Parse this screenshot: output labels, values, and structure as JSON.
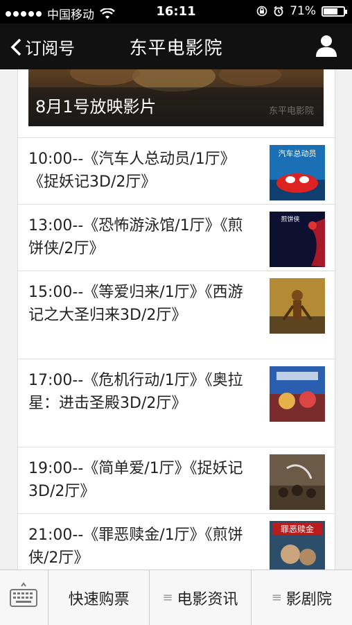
{
  "status_bar": {
    "carrier": "中国移动",
    "time": "16:11",
    "battery": "71%",
    "battery_level": 0.71
  },
  "nav": {
    "back_label": "订阅号",
    "title": "东平电影院"
  },
  "banner": {
    "caption": "8月1号放映影片",
    "watermark": "东平电影院"
  },
  "schedule": [
    {
      "text": "10:00--《汽车人总动员/1厅》《捉妖记3D/2厅》",
      "poster_title": "汽车总动员"
    },
    {
      "text": "13:00--《恐怖游泳馆/1厅》《煎饼侠/2厅》",
      "poster_title": "煎饼侠"
    },
    {
      "text": "15:00--《等爱归来/1厅》《西游记之大圣归来3D/2厅》",
      "poster_title": ""
    },
    {
      "text": "17:00--《危机行动/1厅》《奥拉星：进击圣殿3D/2厅》",
      "poster_title": ""
    },
    {
      "text": "19:00--《简单爱/1厅》《捉妖记3D/2厅》",
      "poster_title": ""
    },
    {
      "text": "21:00--《罪恶赎金/1厅》《煎饼侠/2厅》",
      "poster_title": "罪恶赎金"
    }
  ],
  "bottom_menu": {
    "buy": "快速购票",
    "news": "电影资讯",
    "theater": "影剧院",
    "menu_icon": "≡"
  },
  "icons": {
    "back": "chevron-left-icon",
    "user": "user-icon",
    "keyboard": "keyboard-icon",
    "wifi": "wifi-icon",
    "lock": "orientation-lock-icon",
    "alarm": "alarm-icon"
  }
}
